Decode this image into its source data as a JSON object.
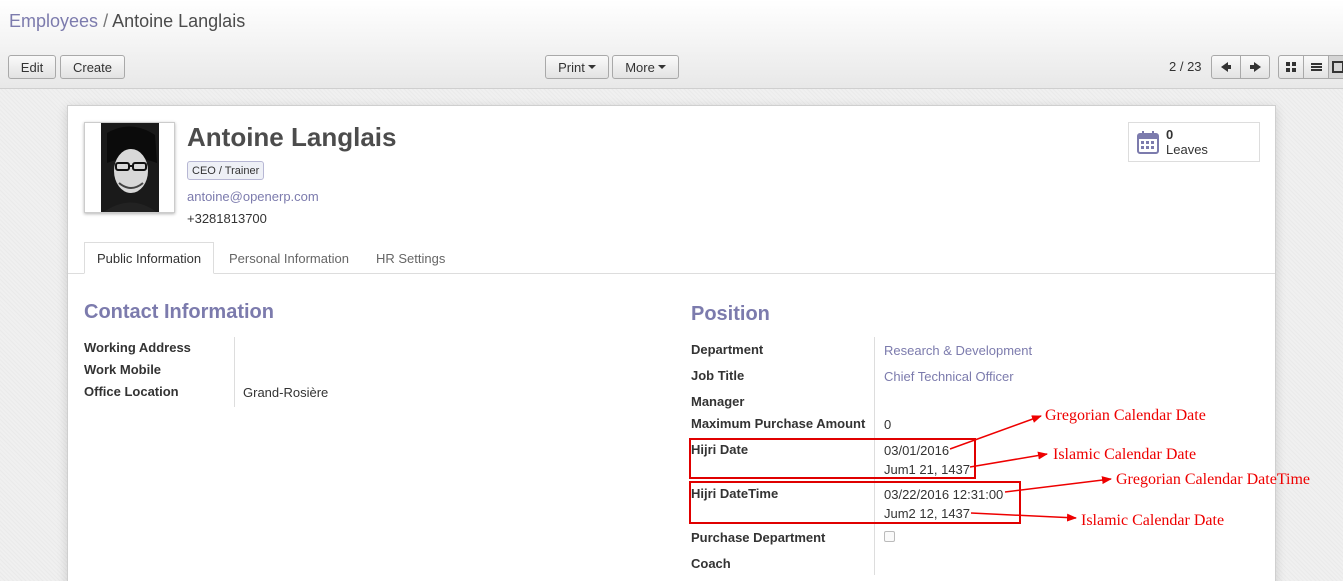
{
  "breadcrumb": {
    "parent": "Employees",
    "separator": "/",
    "current": "Antoine Langlais"
  },
  "toolbar": {
    "edit_label": "Edit",
    "create_label": "Create",
    "print_label": "Print",
    "more_label": "More"
  },
  "pager": {
    "value": "2 / 23"
  },
  "employee": {
    "name": "Antoine Langlais",
    "category_tag": "CEO / Trainer",
    "email": "antoine@openerp.com",
    "phone": "+3281813700"
  },
  "leaves_button": {
    "count": "0",
    "label": "Leaves"
  },
  "tabs": [
    {
      "label": "Public Information",
      "active": true
    },
    {
      "label": "Personal Information",
      "active": false
    },
    {
      "label": "HR Settings",
      "active": false
    }
  ],
  "contact": {
    "title": "Contact Information",
    "fields": [
      {
        "label": "Working Address",
        "value": ""
      },
      {
        "label": "Work Mobile",
        "value": ""
      },
      {
        "label": "Office Location",
        "value": "Grand-Rosière"
      }
    ]
  },
  "position": {
    "title": "Position",
    "department": {
      "label": "Department",
      "value": "Research & Development"
    },
    "job_title": {
      "label": "Job Title",
      "value": "Chief Technical Officer"
    },
    "manager": {
      "label": "Manager",
      "value": ""
    },
    "max_purchase": {
      "label": "Maximum Purchase Amount",
      "value": "0"
    },
    "hijri_date": {
      "label": "Hijri Date",
      "gregorian": "03/01/2016",
      "hijri": "Jum1 21, 1437"
    },
    "hijri_datetime": {
      "label": "Hijri DateTime",
      "gregorian": "03/22/2016 12:31:00",
      "hijri": "Jum2 12, 1437"
    },
    "purchase_department": {
      "label": "Purchase Department",
      "checked": false
    },
    "coach": {
      "label": "Coach",
      "value": ""
    }
  },
  "annotations": {
    "gregorian_date": "Gregorian Calendar Date",
    "islamic_date_1": "Islamic Calendar Date",
    "gregorian_datetime": "Gregorian Calendar DateTime",
    "islamic_date_2": "Islamic Calendar Date"
  },
  "colors": {
    "accent": "#7c7bad",
    "annotation_red": "#ee0000"
  },
  "icons": {
    "leaves": "calendar-icon",
    "pager_prev": "arrow-left-icon",
    "pager_next": "arrow-right-icon",
    "view_kanban": "kanban-view-icon",
    "view_list": "list-view-icon",
    "view_form": "form-view-icon"
  }
}
